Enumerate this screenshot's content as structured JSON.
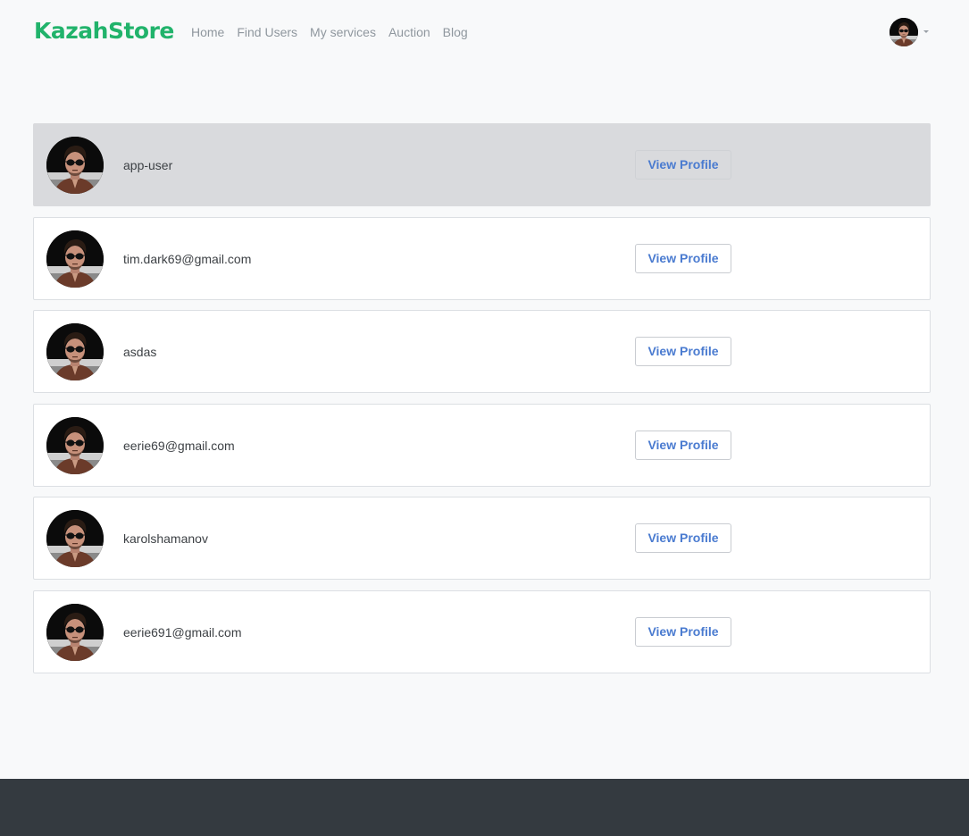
{
  "brand": {
    "name": "KazahStore",
    "color": "#21b36b"
  },
  "nav": {
    "links": [
      {
        "label": "Home"
      },
      {
        "label": "Find Users"
      },
      {
        "label": "My services"
      },
      {
        "label": "Auction"
      },
      {
        "label": "Blog"
      }
    ],
    "user_menu_icon": "chevron-down-icon"
  },
  "users": [
    {
      "name": "app-user",
      "button_label": "View Profile",
      "active": true
    },
    {
      "name": "tim.dark69@gmail.com",
      "button_label": "View Profile",
      "active": false
    },
    {
      "name": "asdas",
      "button_label": "View Profile",
      "active": false
    },
    {
      "name": "eerie69@gmail.com",
      "button_label": "View Profile",
      "active": false
    },
    {
      "name": "karolshamanov",
      "button_label": "View Profile",
      "active": false
    },
    {
      "name": "eerie691@gmail.com",
      "button_label": "View Profile",
      "active": false
    }
  ],
  "colors": {
    "accent_link": "#4a7bd0",
    "footer": "#343a40",
    "active_row": "#d9dadd"
  }
}
